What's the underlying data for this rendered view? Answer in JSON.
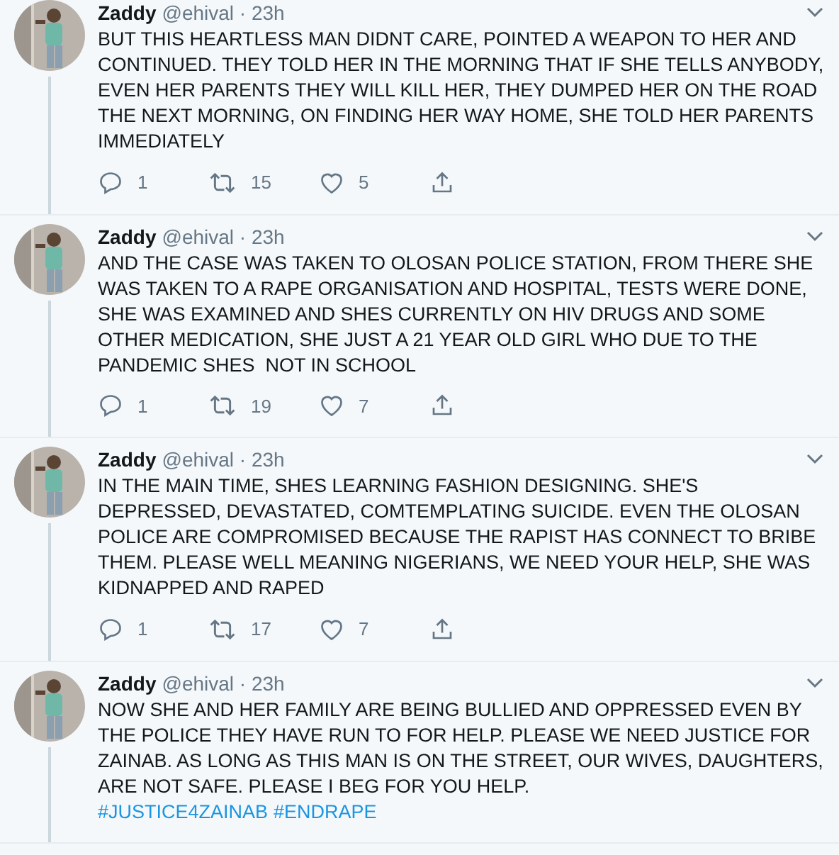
{
  "tweets": [
    {
      "name": "Zaddy",
      "meta": "@ehival · 23h",
      "text": "BUT THIS HEARTLESS MAN DIDNT CARE, POINTED A WEAPON TO HER AND CONTINUED. THEY TOLD HER IN THE MORNING THAT IF SHE TELLS ANYBODY, EVEN HER PARENTS THEY WILL KILL HER, THEY DUMPED HER ON THE ROAD THE NEXT MORNING, ON FINDING HER WAY HOME, SHE TOLD HER PARENTS IMMEDIATELY",
      "replies": "1",
      "retweets": "15",
      "likes": "5",
      "thread_line": true
    },
    {
      "name": "Zaddy",
      "meta": "@ehival · 23h",
      "text": "AND THE CASE WAS TAKEN TO OLOSAN POLICE STATION, FROM THERE SHE WAS TAKEN TO A RAPE ORGANISATION AND HOSPITAL, TESTS WERE DONE, SHE WAS EXAMINED AND SHES CURRENTLY ON HIV DRUGS AND SOME OTHER MEDICATION, SHE JUST A 21 YEAR OLD GIRL WHO DUE TO THE PANDEMIC SHES  NOT IN SCHOOL",
      "replies": "1",
      "retweets": "19",
      "likes": "7",
      "thread_line": true
    },
    {
      "name": "Zaddy",
      "meta": "@ehival · 23h",
      "text": "IN THE MAIN TIME, SHES LEARNING FASHION DESIGNING. SHE'S DEPRESSED, DEVASTATED, COMTEMPLATING SUICIDE. EVEN THE OLOSAN POLICE ARE COMPROMISED BECAUSE THE RAPIST HAS CONNECT TO BRIBE THEM. PLEASE WELL MEANING NIGERIANS, WE NEED YOUR HELP, SHE WAS KIDNAPPED AND RAPED",
      "replies": "1",
      "retweets": "17",
      "likes": "7",
      "thread_line": true
    },
    {
      "name": "Zaddy",
      "meta": "@ehival · 23h",
      "text": "NOW SHE AND HER FAMILY ARE BEING BULLIED AND OPPRESSED EVEN BY THE POLICE THEY HAVE RUN TO FOR HELP. PLEASE WE NEED JUSTICE FOR ZAINAB. AS LONG AS THIS MAN IS ON THE STREET, OUR WIVES, DAUGHTERS,  ARE NOT SAFE. PLEASE I BEG FOR YOU HELP.",
      "hashtags": [
        "#JUSTICE4ZAINAB",
        "#ENDRAPE"
      ],
      "thread_line": true
    }
  ]
}
